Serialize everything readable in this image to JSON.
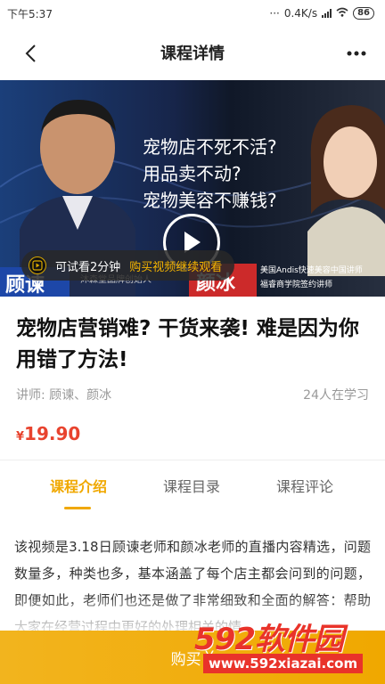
{
  "status_bar": {
    "time": "下午5:37",
    "network_speed": "0.4K/s",
    "battery": "86"
  },
  "nav": {
    "title": "课程详情",
    "back_icon": "chevron-left-icon",
    "more_icon": "more-horizontal-icon"
  },
  "video": {
    "slogans": [
      "宠物店不死不活?",
      "用品卖不动?",
      "宠物美容不赚钱?"
    ],
    "left_name": "顾谏",
    "left_tag": "沐森堂品牌创始人",
    "right_name": "颜冰",
    "right_caption": [
      "美国Andis快速美容中国讲师",
      "福睿商学院签约讲师"
    ],
    "trial_text": "可试看2分钟",
    "trial_link": "购买视频继续观看"
  },
  "course": {
    "title": "宠物店营销难? 干货来袭! 难是因为你用错了方法!",
    "lecturer": "讲师: 顾谏、颜冰",
    "learners": "24人在学习",
    "price_symbol": "¥",
    "price": "19.90"
  },
  "tabs": [
    {
      "label": "课程介绍",
      "active": true
    },
    {
      "label": "课程目录",
      "active": false
    },
    {
      "label": "课程评论",
      "active": false
    }
  ],
  "intro_text": "该视频是3.18日顾谏老师和颜冰老师的直播内容精选，问题数量多，种类也多，基本涵盖了每个店主都会问到的问题，即便如此，老师们也还是做了非常细致和全面的解答：帮助大家在经营过程中更好的处理相关的情",
  "buy_bar": {
    "label": "购买",
    "price_prefix": "¥"
  },
  "watermark": {
    "logo_num": "592",
    "logo_text": "软件园",
    "url": "www.592xiazai.com"
  },
  "colors": {
    "accent": "#f0a800",
    "price": "#e8432e",
    "trial_link": "#f5b400"
  }
}
